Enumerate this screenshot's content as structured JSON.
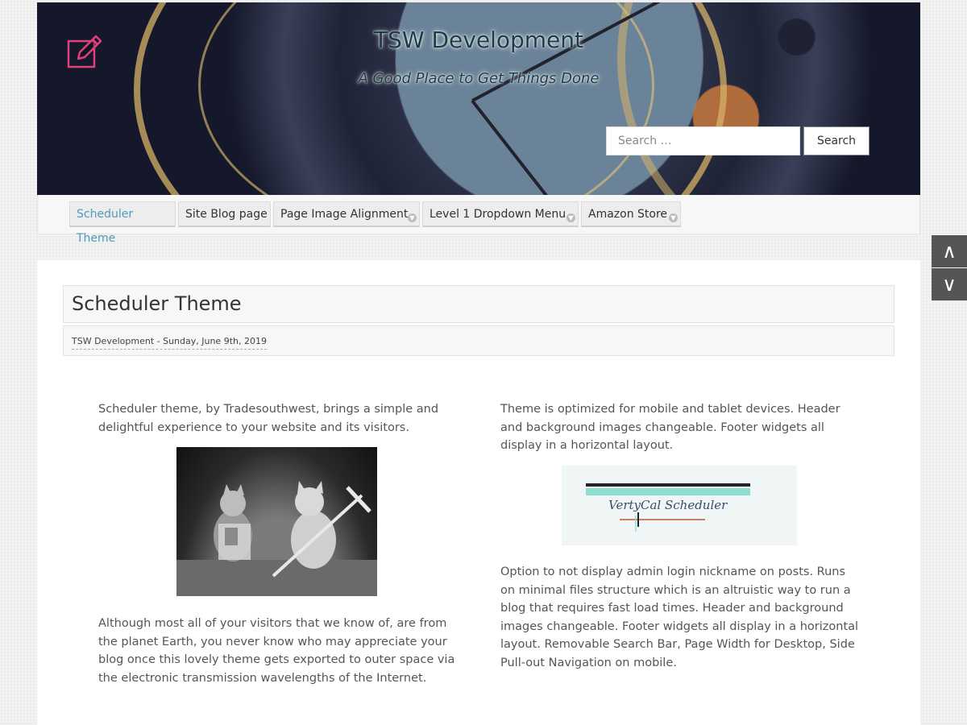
{
  "site": {
    "title": "TSW Development",
    "tagline": "A Good Place to Get Things Done"
  },
  "search": {
    "placeholder": "Search …",
    "button_label": "Search"
  },
  "nav": {
    "items": [
      {
        "label": "Scheduler Theme",
        "active": true,
        "has_dropdown": false
      },
      {
        "label": "Site Blog page",
        "active": false,
        "has_dropdown": false
      },
      {
        "label": "Page Image Alignment",
        "active": false,
        "has_dropdown": true
      },
      {
        "label": "Level 1 Dropdown Menu",
        "active": false,
        "has_dropdown": true
      },
      {
        "label": "Amazon Store",
        "active": false,
        "has_dropdown": true
      }
    ]
  },
  "scroll": {
    "up_icon": "∧",
    "down_icon": "∨"
  },
  "post": {
    "title": "Scheduler Theme",
    "meta": "TSW Development - Sunday, June 9th, 2019",
    "left_intro": "Scheduler theme, by Tradesouthwest, brings a simple and delightful experience to your website and its visitors.",
    "left_body": "Although most all of your visitors that we know of, are from the planet Earth, you never know who may appreciate your blog once this lovely theme gets exported to outer space via the electronic transmission wavelengths of the Internet.",
    "right_intro": "Theme is optimized for mobile and tablet devices. Header and background images changeable. Footer widgets all display in a horizontal layout.",
    "right_image_text": "VertyCal Scheduler",
    "right_body": "Option to not display admin login nickname on posts. Runs on minimal files structure which is an altruistic way to run a blog that requires fast load times. Header and background images changeable. Footer widgets all display in a horizontal layout. Removable Search Bar, Page Width for Desktop, Side Pull-out Navigation on mobile."
  },
  "colors": {
    "accent": "#5b9bb8",
    "logo": "#e0407a"
  }
}
